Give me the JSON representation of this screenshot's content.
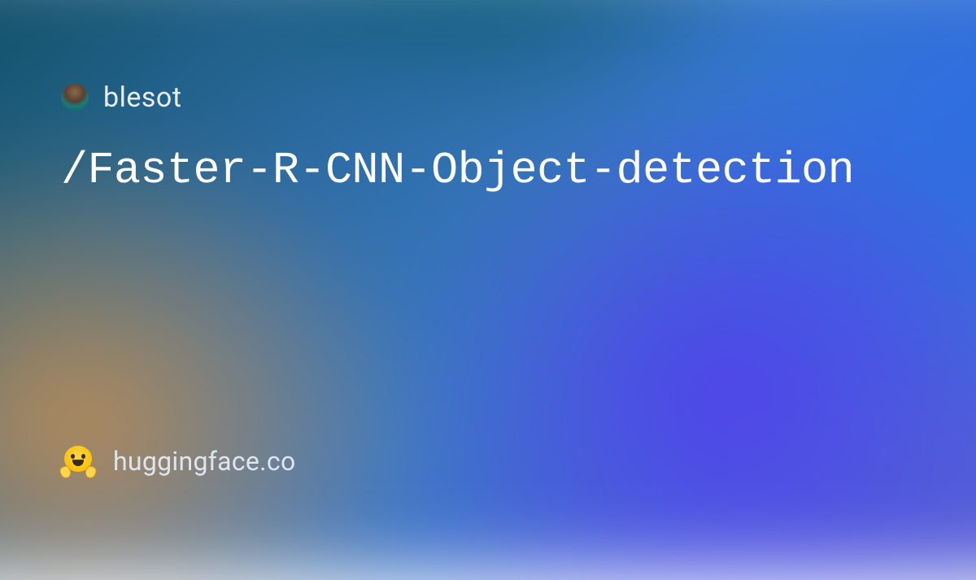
{
  "user": {
    "name": "blesot"
  },
  "repo": {
    "path": "/Faster-R-CNN-Object-detection"
  },
  "footer": {
    "site": "huggingface.co"
  }
}
